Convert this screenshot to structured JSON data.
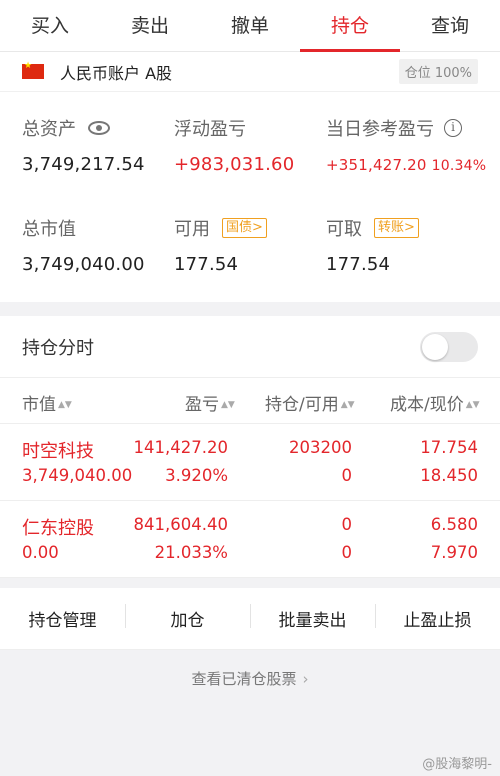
{
  "tabs": [
    "买入",
    "卖出",
    "撤单",
    "持仓",
    "查询"
  ],
  "account": {
    "label": "人民币账户 A股",
    "position_badge": "仓位 100%"
  },
  "summary": {
    "total_assets": {
      "label": "总资产",
      "value": "3,749,217.54"
    },
    "floating_pl": {
      "label": "浮动盈亏",
      "value": "+983,031.60"
    },
    "daily_pl": {
      "label": "当日参考盈亏",
      "value": "+351,427.20",
      "pct": "10.34%"
    },
    "market_value": {
      "label": "总市值",
      "value": "3,749,040.00"
    },
    "available": {
      "label": "可用",
      "tag": "国债>",
      "value": "177.54"
    },
    "withdrawable": {
      "label": "可取",
      "tag": "转账>",
      "value": "177.54"
    }
  },
  "timeshare": {
    "label": "持仓分时"
  },
  "table": {
    "headers": [
      "市值",
      "盈亏",
      "持仓/可用",
      "成本/现价"
    ],
    "rows": [
      {
        "name": "时空科技",
        "market_value": "3,749,040.00",
        "pl": "141,427.20",
        "pl_pct": "3.920%",
        "holding": "203200",
        "available": "0",
        "cost": "17.754",
        "price": "18.450"
      },
      {
        "name": "仁东控股",
        "market_value": "0.00",
        "pl": "841,604.40",
        "pl_pct": "21.033%",
        "holding": "0",
        "available": "0",
        "cost": "6.580",
        "price": "7.970"
      }
    ]
  },
  "actions": [
    "持仓管理",
    "加仓",
    "批量卖出",
    "止盈止损"
  ],
  "cleared_link": "查看已清仓股票",
  "watermark": "@股海黎明-",
  "colors": {
    "accent": "#e3262b",
    "tag": "#f0a020"
  }
}
